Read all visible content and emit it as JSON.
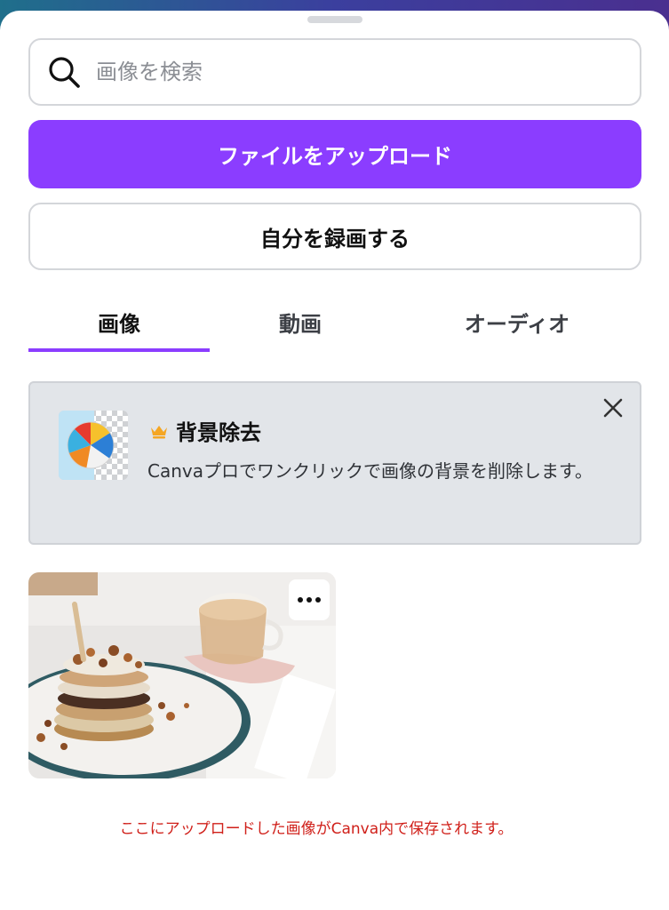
{
  "search": {
    "placeholder": "画像を検索",
    "icon": "search-icon"
  },
  "buttons": {
    "upload_label": "ファイルをアップロード",
    "record_label": "自分を録画する"
  },
  "tabs": [
    {
      "label": "画像",
      "active": true
    },
    {
      "label": "動画",
      "active": false
    },
    {
      "label": "オーディオ",
      "active": false
    }
  ],
  "promo": {
    "title": "背景除去",
    "description": "Canvaプロでワンクリックで画像の背景を削除します。",
    "badge_icon": "crown-icon"
  },
  "gallery": [
    {
      "kind": "uploaded-image",
      "subject": "pancakes-photo"
    }
  ],
  "note": "ここにアップロードした画像がCanva内で保存されます。",
  "colors": {
    "accent": "#8b3dff",
    "note": "#d0201a",
    "crown": "#f5a623"
  }
}
